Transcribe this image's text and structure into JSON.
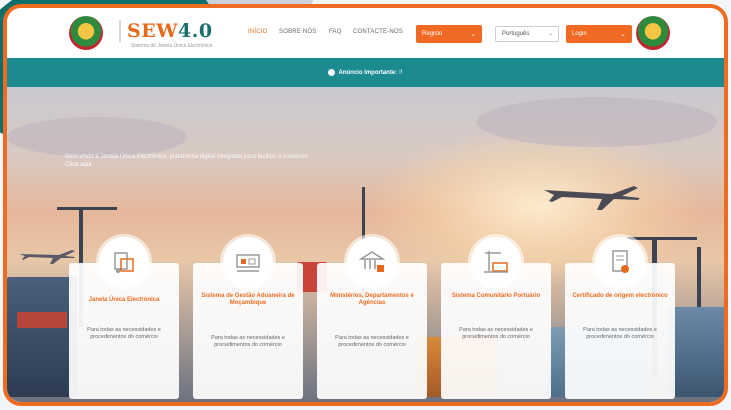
{
  "header": {
    "brand": "SEW",
    "brand_version": "4.0",
    "brand_subtitle": "Sistema de Janela Única Electrónica",
    "nav": [
      "INÍCIO",
      "SOBRE NÓS",
      "FAQ",
      "CONTACTE-NOS"
    ],
    "registo_label": "Registo",
    "language": "Português",
    "login_label": "Login"
  },
  "notice": {
    "label": "Anúncio Importante:",
    "tail": "!!"
  },
  "hero": {
    "intro": "Bem-vindo à Janela Única Electrónica, plataforma digital integrada para facilitar o comércio",
    "link": "Clica aqui"
  },
  "cards": [
    {
      "title": "Janela Única Electrónica",
      "desc": "Para todas as necessidades e procedimentos do comércio"
    },
    {
      "title": "Sistema de Gestão Aduaneira de Moçambique",
      "desc": "Para todas as necessidades e procedimentos do comércio"
    },
    {
      "title": "Ministérios, Departamentos e Agências",
      "desc": "Para todas as necessidades e procedimentos do comércio"
    },
    {
      "title": "Sistema Comunitário Portuário",
      "desc": "Para todas as necessidades e procedimentos do comércio"
    },
    {
      "title": "Certificado de origem electrónico",
      "desc": "Para todas as necessidades e procedimentos do comércio"
    }
  ],
  "colors": {
    "accent": "#ee6c22",
    "teal": "#1b8b8f",
    "brand_green": "#1b6f6a"
  }
}
